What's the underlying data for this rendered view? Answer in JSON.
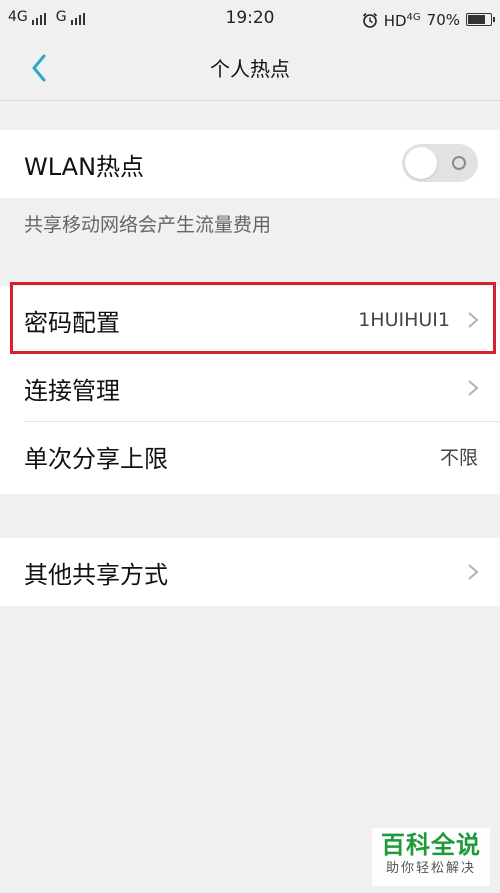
{
  "status_bar": {
    "network_1": "4G",
    "network_2": "G",
    "time": "19:20",
    "hd": "HD",
    "net_type": "4G",
    "battery": "70%",
    "battery_level": 0.7
  },
  "header": {
    "title": "个人热点",
    "back_icon": "chevron-left-icon"
  },
  "hotspot": {
    "label": "WLAN热点",
    "enabled": false,
    "description": "共享移动网络会产生流量费用"
  },
  "settings": {
    "items": [
      {
        "label": "密码配置",
        "value": "1HUIHUI1"
      },
      {
        "label": "连接管理",
        "value": ""
      },
      {
        "label": "单次分享上限",
        "value": "不限"
      }
    ]
  },
  "other": {
    "label": "其他共享方式"
  },
  "watermark": {
    "main": "百科全说",
    "sub": "助你轻松解决"
  },
  "colors": {
    "accent": "#2fa8c8",
    "highlight": "#d6202f",
    "watermark": "#1f9a3a"
  }
}
